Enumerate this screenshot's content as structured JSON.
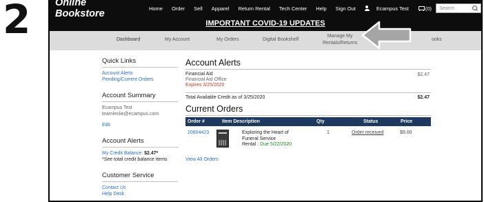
{
  "step_number": "2",
  "header": {
    "brand": "Online Bookstore",
    "nav": [
      "Home",
      "Order",
      "Sell",
      "Apparel",
      "Return Rental",
      "Tech Center",
      "Help",
      "Sign Out"
    ],
    "user": "Ecampus Test",
    "cart": "(0)",
    "search_placeholder": "Search"
  },
  "banner": "IMPORTANT COVID-19 UPDATES",
  "subnav": {
    "items": [
      "Dashboard",
      "My Account",
      "My Orders",
      "Digital Bookshelf",
      "Manage My",
      "Rentals/Returns",
      "ooks"
    ]
  },
  "sidebar": {
    "quick_links_title": "Quick Links",
    "quick_links": [
      "Account Alerts",
      "Pending/Current Orders"
    ],
    "account_summary_title": "Account Summary",
    "account_name": "Ecampus Test",
    "account_email": "teamleslie@ecampus.com",
    "edit": "Edit",
    "account_alerts_title": "Account Alerts",
    "credit_label": "My Credit Balance: ",
    "credit_value": "$2.47*",
    "credit_note": "*See total credit balance items",
    "customer_service_title": "Customer Service",
    "contact": "Contact Us",
    "help_desk": "Help Desk"
  },
  "alerts": {
    "title": "Account Alerts",
    "item_title": "Financial Aid",
    "item_source": "Financial Aid Office",
    "item_expires": "Expires 3/25/2020",
    "item_amount": "$2.47",
    "total_label": "Total Available Credit as of 3/25/2020",
    "total_amount": "$2.47"
  },
  "orders": {
    "title": "Current Orders",
    "columns": [
      "Order #",
      "Item Description",
      "Qty",
      "Status",
      "Price"
    ],
    "rows": [
      {
        "order": "20604423",
        "desc_line1": "Exploring the Heart of",
        "desc_line2": "Funeral Service",
        "rental_label": "Rental : ",
        "due": "Due 5/22/2020",
        "qty": "1",
        "status": "Order received",
        "price": "$9.00"
      }
    ],
    "view_all": "View All Orders"
  },
  "colors": {
    "topbar": "#0d0d0d",
    "subnav": "#dcdcdc",
    "table_header": "#1d3a5e",
    "link": "#2a6fbf",
    "expires": "#c0392b",
    "due": "#1e8a1e",
    "arrow": "#a5a5a5"
  },
  "icons": [
    "user-icon",
    "cart-icon",
    "search-icon",
    "arrow-pointer-icon"
  ]
}
